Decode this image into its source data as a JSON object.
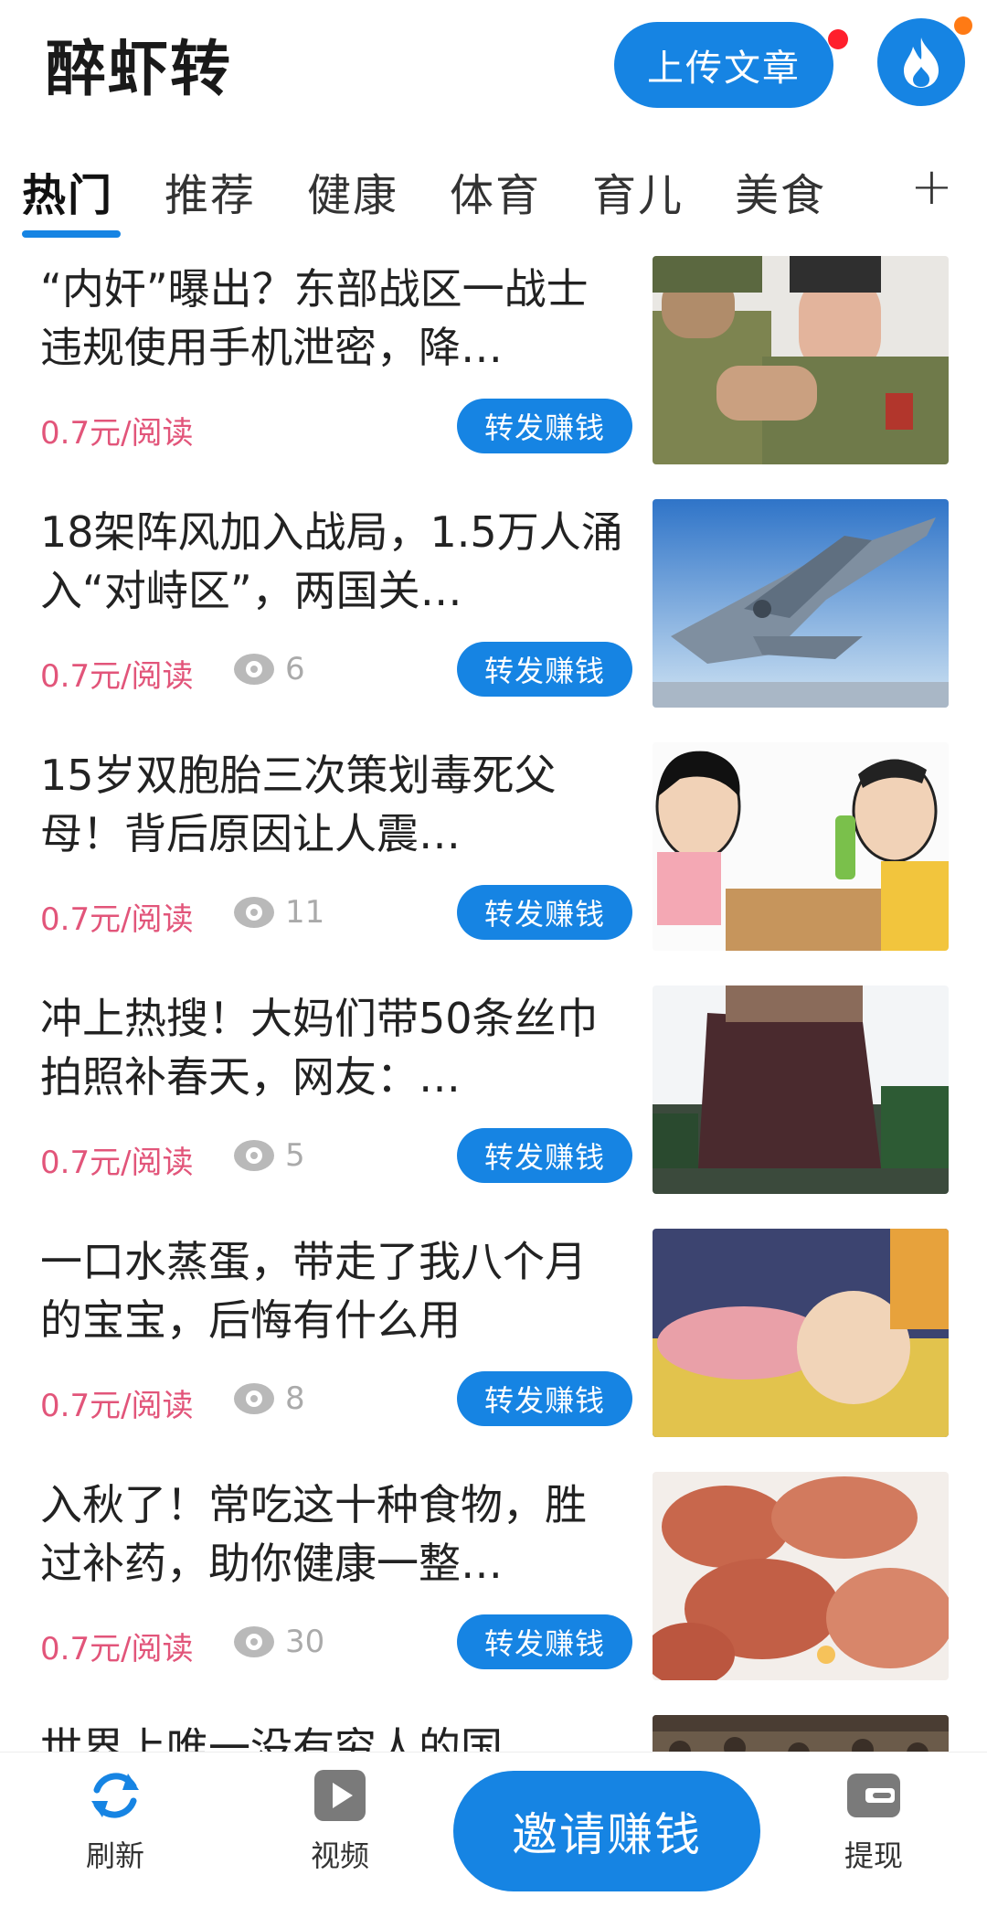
{
  "header": {
    "app_title": "醉虾转",
    "upload_label": "上传文章"
  },
  "tabs": [
    {
      "label": "热门",
      "active": true
    },
    {
      "label": "推荐",
      "active": false
    },
    {
      "label": "健康",
      "active": false
    },
    {
      "label": "体育",
      "active": false
    },
    {
      "label": "育儿",
      "active": false
    },
    {
      "label": "美食",
      "active": false
    }
  ],
  "tab_add_label": "+",
  "articles": [
    {
      "title": "“内奸”曝出？东部战区一战士违规使用手机泄密，降…",
      "price": "0.7元/阅读",
      "views": "",
      "share_label": "转发赚钱",
      "thumb": "soldier-photo"
    },
    {
      "title": "18架阵风加入战局，1.5万人涌入“对峙区”，两国关…",
      "price": "0.7元/阅读",
      "views": "6",
      "share_label": "转发赚钱",
      "thumb": "fighter-jet-photo"
    },
    {
      "title": "15岁双胞胎三次策划毒死父母！背后原因让人震…",
      "price": "0.7元/阅读",
      "views": "11",
      "share_label": "转发赚钱",
      "thumb": "cartoon-couple-illustration"
    },
    {
      "title": "冲上热搜！大妈们带50条丝巾拍照补春天，网友：…",
      "price": "0.7元/阅读",
      "views": "5",
      "share_label": "转发赚钱",
      "thumb": "scarves-photo"
    },
    {
      "title": "一口水蒸蛋，带走了我八个月的宝宝，后悔有什么用",
      "price": "0.7元/阅读",
      "views": "8",
      "share_label": "转发赚钱",
      "thumb": "baby-photo"
    },
    {
      "title": "入秋了！常吃这十种食物，胜过补药，助你健康一整…",
      "price": "0.7元/阅读",
      "views": "30",
      "share_label": "转发赚钱",
      "thumb": "sweet-potato-photo"
    },
    {
      "title": "世界上唯一没有穷人的国",
      "price": "",
      "views": "",
      "share_label": "",
      "thumb": "crowd-photo"
    }
  ],
  "bottom_nav": {
    "refresh": "刷新",
    "video": "视频",
    "invite": "邀请赚钱",
    "withdraw": "提现"
  },
  "colors": {
    "accent": "#1684e3",
    "price": "#e2557a",
    "badge_red": "#ff1f2c",
    "badge_orange": "#ff7a14"
  }
}
